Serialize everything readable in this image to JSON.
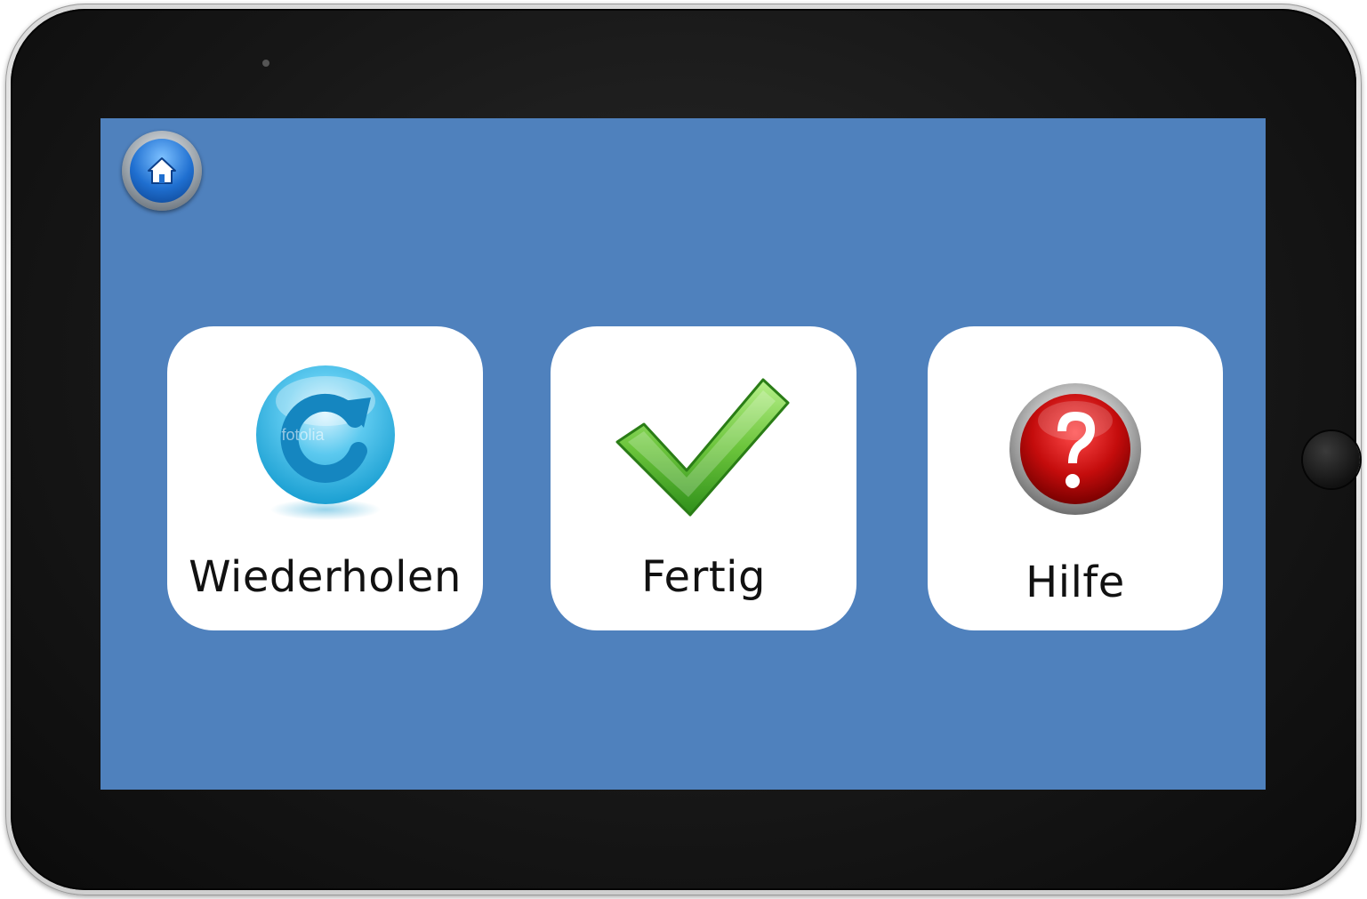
{
  "screen": {
    "background_color": "#4f81bd",
    "home_button": {
      "icon": "home-icon"
    }
  },
  "tiles": [
    {
      "label": "Wiederholen",
      "icon": "refresh-icon",
      "watermark": "fotolia"
    },
    {
      "label": "Fertig",
      "icon": "checkmark-icon"
    },
    {
      "label": "Hilfe",
      "icon": "help-icon"
    }
  ]
}
